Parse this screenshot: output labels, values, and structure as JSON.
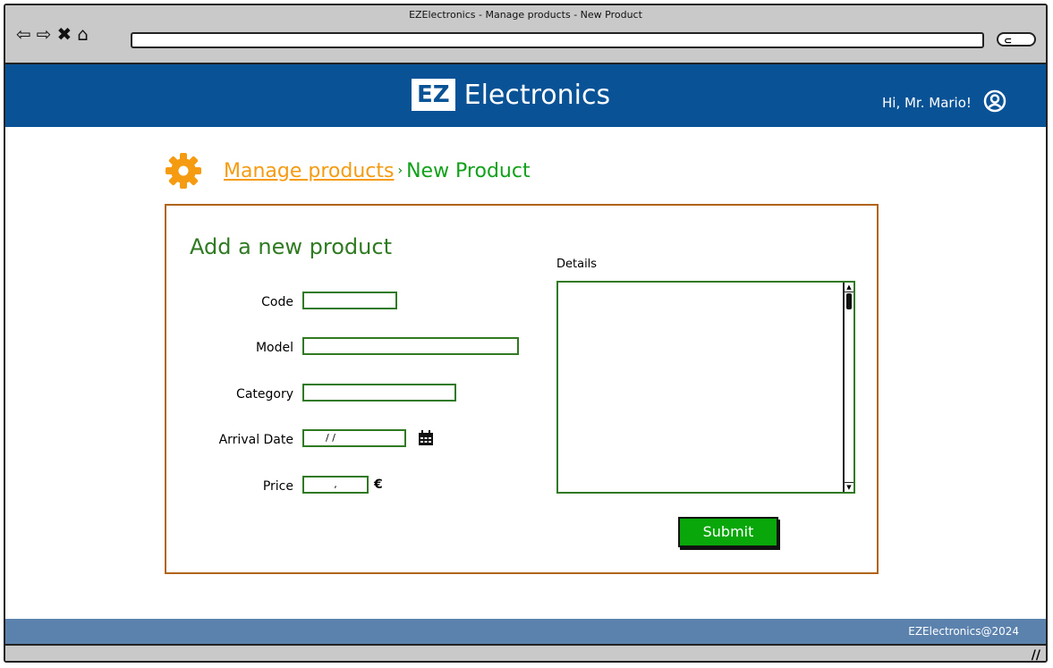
{
  "browser": {
    "window_title": "EZElectronics - Manage products - New Product",
    "nav_icons": [
      "back-icon",
      "forward-icon",
      "close-icon",
      "home-icon"
    ],
    "search_icon": "search-icon"
  },
  "header": {
    "logo_mark": "EZ",
    "logo_text": "Electronics",
    "greeting": "Hi, Mr. Mario!",
    "user_icon": "user-icon",
    "bg_color": "#0a5296"
  },
  "breadcrumb": {
    "icon": "gear-icon",
    "parent": "Manage products",
    "separator": "›",
    "current": "New Product"
  },
  "form": {
    "title": "Add a new product",
    "code_label": "Code",
    "code_value": "",
    "model_label": "Model",
    "model_value": "",
    "category_label": "Category",
    "category_value": "",
    "arrival_label": "Arrival Date",
    "arrival_value": "/ /",
    "price_label": "Price",
    "price_value": ",",
    "currency": "€",
    "details_label": "Details",
    "details_value": "",
    "submit_label": "Submit"
  },
  "footer": {
    "text": "EZElectronics@2024"
  }
}
